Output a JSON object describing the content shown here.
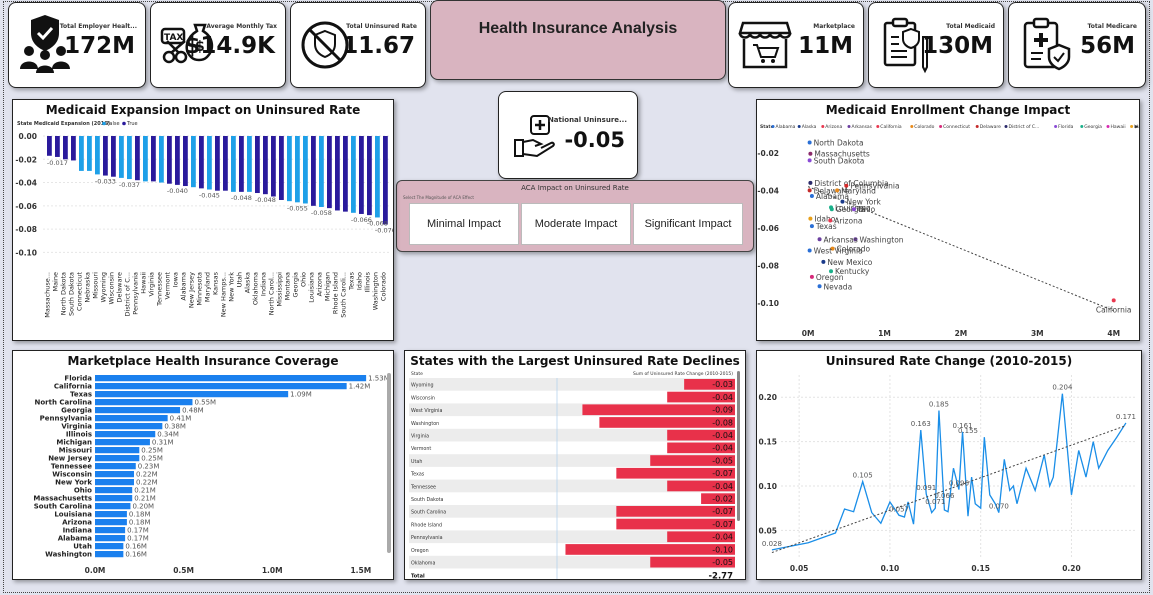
{
  "kpis": {
    "employer": {
      "label": "Total Employer Healt...",
      "value": "172M"
    },
    "tax": {
      "label": "Average Monthly Tax",
      "value": "$14.9K"
    },
    "uninsured": {
      "label": "Total Uninsured Rate",
      "value": "11.67"
    },
    "marketplace": {
      "label": "Marketplace",
      "value": "11M"
    },
    "medicaid": {
      "label": "Total Medicaid",
      "value": "130M"
    },
    "medicare": {
      "label": "Total Medicare",
      "value": "56M"
    }
  },
  "header": {
    "title": "Health Insurance Analysis"
  },
  "national": {
    "label": "National Uninsure...",
    "value": "-0.05"
  },
  "aca_slicer": {
    "title": "ACA Impact on Uninsured Rate",
    "subtitle": "Select The Magnitude of ACA Effect",
    "options": [
      "Minimal Impact",
      "Moderate Impact",
      "Significant Impact"
    ]
  },
  "colors": {
    "false": "#1ea0e8",
    "true": "#2a1a9c",
    "bar": "#1a80ee",
    "decline": "#e8314a",
    "line": "#1a8ee8"
  },
  "chart_data": [
    {
      "id": "medicaid_expansion",
      "type": "bar",
      "title": "Medicaid Expansion Impact on Uninsured Rate",
      "legend_title": "State Medicaid Expansion (2016)",
      "legend": [
        "False",
        "True"
      ],
      "ylim": [
        -0.11,
        0.0
      ],
      "yticks": [
        "0.00",
        "-0.02",
        "-0.04",
        "-0.06",
        "-0.08",
        "-0.10"
      ],
      "categories": [
        "Massachuse...",
        "Maine",
        "North Dakota",
        "South Dakota",
        "Connecticut",
        "Nebraska",
        "Missouri",
        "Wyoming",
        "Wisconsin",
        "Delaware",
        "District of C...",
        "Pennsylvania",
        "Hawaii",
        "Virginia",
        "Tennessee",
        "Vermont",
        "Iowa",
        "Alabama",
        "New Jersey",
        "Minnesota",
        "Maryland",
        "Kansas",
        "New Hamps...",
        "New York",
        "Utah",
        "Alaska",
        "Oklahoma",
        "Indiana",
        "North Carol...",
        "Mississippi",
        "Montana",
        "Georgia",
        "Ohio",
        "Louisiana",
        "Arizona",
        "Michigan",
        "Rhode Island",
        "South Caroli...",
        "Texas",
        "Idaho",
        "Illinois",
        "Washington",
        "Colorado"
      ],
      "values": [
        -0.017,
        -0.018,
        -0.02,
        -0.021,
        -0.03,
        -0.03,
        -0.033,
        -0.034,
        -0.035,
        -0.036,
        -0.037,
        -0.038,
        -0.039,
        -0.039,
        -0.04,
        -0.041,
        -0.042,
        -0.043,
        -0.044,
        -0.045,
        -0.046,
        -0.047,
        -0.047,
        -0.048,
        -0.048,
        -0.048,
        -0.049,
        -0.05,
        -0.052,
        -0.055,
        -0.056,
        -0.057,
        -0.058,
        -0.06,
        -0.061,
        -0.062,
        -0.064,
        -0.065,
        -0.066,
        -0.067,
        -0.068,
        -0.07,
        -0.076
      ],
      "expansion": [
        true,
        true,
        true,
        true,
        false,
        false,
        false,
        true,
        true,
        false,
        false,
        true,
        false,
        true,
        false,
        true,
        true,
        true,
        false,
        true,
        false,
        true,
        true,
        false,
        true,
        false,
        true,
        true,
        true,
        true,
        false,
        false,
        false,
        true,
        false,
        true,
        true,
        true,
        false,
        true,
        true,
        false,
        true
      ],
      "data_labels": [
        {
          "i": 1,
          "text": "-0.017"
        },
        {
          "i": 7,
          "text": "-0.033"
        },
        {
          "i": 10,
          "text": "-0.037"
        },
        {
          "i": 16,
          "text": "-0.040"
        },
        {
          "i": 20,
          "text": "-0.045"
        },
        {
          "i": 24,
          "text": "-0.048"
        },
        {
          "i": 27,
          "text": "-0.048"
        },
        {
          "i": 31,
          "text": "-0.055"
        },
        {
          "i": 34,
          "text": "-0.058"
        },
        {
          "i": 39,
          "text": "-0.066"
        },
        {
          "i": 41,
          "text": "-0.068"
        },
        {
          "i": 42,
          "text": "-0.076"
        }
      ]
    },
    {
      "id": "medicaid_enrollment",
      "type": "scatter",
      "title": "Medicaid Enrollment Change Impact",
      "legend_title": "State",
      "legend": [
        "Alabama",
        "Alaska",
        "Arizona",
        "Arkansas",
        "California",
        "Colorado",
        "Connecticut",
        "Delaware",
        "District of C...",
        "Florida",
        "Georgia",
        "Hawaii",
        "Idaho"
      ],
      "legend_colors": [
        "#2a6fd6",
        "#1a3a8a",
        "#e8384f",
        "#6b3fa0",
        "#e8384f",
        "#e88a1a",
        "#d62a7a",
        "#c42a2a",
        "#2a2a6a",
        "#8a4ad6",
        "#1ab08a",
        "#d62ab0",
        "#e8a01a"
      ],
      "xticks": [
        "0M",
        "1M",
        "2M",
        "3M",
        "4M"
      ],
      "xlim": [
        -0.25,
        4.2
      ],
      "yticks": [
        "-0.02",
        "-0.04",
        "-0.06",
        "-0.08",
        "-0.10"
      ],
      "ylim": [
        -0.11,
        -0.01
      ],
      "points": [
        {
          "label": "North Dakota",
          "x": 0.02,
          "y": -0.0145,
          "c": "#2a6fd6"
        },
        {
          "label": "Massachusetts",
          "x": 0.03,
          "y": -0.0205,
          "c": "#8a2a6a"
        },
        {
          "label": "South Dakota",
          "x": 0.02,
          "y": -0.024,
          "c": "#8a4ad6"
        },
        {
          "label": "District of Columbia",
          "x": 0.03,
          "y": -0.036,
          "c": "#2a2a6a"
        },
        {
          "label": "Pennsylvania",
          "x": 0.5,
          "y": -0.0375,
          "c": "#d62a2a"
        },
        {
          "label": "Delaware",
          "x": 0.02,
          "y": -0.04,
          "c": "#c42a2a"
        },
        {
          "label": "Maryland",
          "x": 0.38,
          "y": -0.04,
          "c": "#e88a1a"
        },
        {
          "label": "Alabama",
          "x": 0.05,
          "y": -0.043,
          "c": "#2a6fd6"
        },
        {
          "label": "New York",
          "x": 0.45,
          "y": -0.046,
          "c": "#1a3a8a"
        },
        {
          "label": "Louisiana",
          "x": 0.3,
          "y": -0.049,
          "c": "#1ab08a"
        },
        {
          "label": "Georgia",
          "x": 0.31,
          "y": -0.05,
          "c": "#1ab08a"
        },
        {
          "label": "Ohio",
          "x": 0.6,
          "y": -0.05,
          "c": "#8a4ad6"
        },
        {
          "label": "Idaho",
          "x": 0.03,
          "y": -0.055,
          "c": "#e8a01a"
        },
        {
          "label": "Arizona",
          "x": 0.29,
          "y": -0.056,
          "c": "#e8384f"
        },
        {
          "label": "Texas",
          "x": 0.05,
          "y": -0.059,
          "c": "#2a6fd6"
        },
        {
          "label": "Washington",
          "x": 0.62,
          "y": -0.066,
          "c": "#6b3fa0"
        },
        {
          "label": "Arkansas",
          "x": 0.15,
          "y": -0.066,
          "c": "#6b3fa0"
        },
        {
          "label": "Colorado",
          "x": 0.32,
          "y": -0.071,
          "c": "#e88a1a"
        },
        {
          "label": "West Virginia",
          "x": 0.02,
          "y": -0.072,
          "c": "#2a6fd6"
        },
        {
          "label": "New Mexico",
          "x": 0.2,
          "y": -0.078,
          "c": "#1a3a8a"
        },
        {
          "label": "Kentucky",
          "x": 0.3,
          "y": -0.083,
          "c": "#1ab08a"
        },
        {
          "label": "Oregon",
          "x": 0.05,
          "y": -0.086,
          "c": "#d62a7a"
        },
        {
          "label": "Nevada",
          "x": 0.15,
          "y": -0.091,
          "c": "#2a6fd6"
        },
        {
          "label": "California",
          "x": 4.0,
          "y": -0.0985,
          "c": "#e8384f"
        }
      ],
      "trend": [
        [
          0.0,
          -0.038
        ],
        [
          4.0,
          -0.104
        ]
      ]
    },
    {
      "id": "marketplace",
      "type": "bar",
      "orientation": "horizontal",
      "title": "Marketplace Health Insurance Coverage",
      "xticks": [
        "0.0M",
        "0.5M",
        "1.0M",
        "1.5M"
      ],
      "xlim": [
        0,
        1.58
      ],
      "categories": [
        "Florida",
        "California",
        "Texas",
        "North Carolina",
        "Georgia",
        "Pennsylvania",
        "Virginia",
        "Illinois",
        "Michigan",
        "Missouri",
        "New Jersey",
        "Tennessee",
        "Wisconsin",
        "New York",
        "Ohio",
        "Massachusetts",
        "South Carolina",
        "Louisiana",
        "Arizona",
        "Indiana",
        "Alabama",
        "Utah",
        "Washington"
      ],
      "values": [
        1.53,
        1.42,
        1.09,
        0.55,
        0.48,
        0.41,
        0.38,
        0.34,
        0.31,
        0.25,
        0.25,
        0.23,
        0.22,
        0.22,
        0.21,
        0.21,
        0.2,
        0.18,
        0.18,
        0.17,
        0.17,
        0.16,
        0.16
      ],
      "value_labels": [
        "1.53M",
        "1.42M",
        "1.09M",
        "0.55M",
        "0.48M",
        "0.41M",
        "0.38M",
        "0.34M",
        "0.31M",
        "0.25M",
        "0.25M",
        "0.23M",
        "0.22M",
        "0.22M",
        "0.21M",
        "0.21M",
        "0.20M",
        "0.18M",
        "0.18M",
        "0.17M",
        "0.17M",
        "0.16M",
        "0.16M"
      ]
    },
    {
      "id": "largest_declines",
      "type": "table",
      "title": "States with the Largest Uninsured Rate Declines",
      "columns": [
        "State",
        "Sum of Uninsured Rate Change (2010-2015)"
      ],
      "rows": [
        {
          "state": "Wyoming",
          "value": -0.03,
          "label": "-0.03"
        },
        {
          "state": "Wisconsin",
          "value": -0.04,
          "label": "-0.04"
        },
        {
          "state": "West Virginia",
          "value": -0.09,
          "label": "-0.09"
        },
        {
          "state": "Washington",
          "value": -0.08,
          "label": "-0.08"
        },
        {
          "state": "Virginia",
          "value": -0.04,
          "label": "-0.04"
        },
        {
          "state": "Vermont",
          "value": -0.04,
          "label": "-0.04"
        },
        {
          "state": "Utah",
          "value": -0.05,
          "label": "-0.05"
        },
        {
          "state": "Texas",
          "value": -0.07,
          "label": "-0.07"
        },
        {
          "state": "Tennessee",
          "value": -0.04,
          "label": "-0.04"
        },
        {
          "state": "South Dakota",
          "value": -0.02,
          "label": "-0.02"
        },
        {
          "state": "South Carolina",
          "value": -0.07,
          "label": "-0.07"
        },
        {
          "state": "Rhode Island",
          "value": -0.07,
          "label": "-0.07"
        },
        {
          "state": "Pennsylvania",
          "value": -0.04,
          "label": "-0.04"
        },
        {
          "state": "Oregon",
          "value": -0.1,
          "label": "-0.10"
        },
        {
          "state": "Oklahoma",
          "value": -0.05,
          "label": "-0.05"
        }
      ],
      "total": {
        "label": "Total",
        "value": "-2.77"
      }
    },
    {
      "id": "uninsured_change",
      "type": "line",
      "title": "Uninsured Rate Change (2010-2015)",
      "xticks": [
        "0.05",
        "0.10",
        "0.15",
        "0.20"
      ],
      "xlim": [
        0.04,
        0.235
      ],
      "yticks": [
        "0.05",
        "0.10",
        "0.15",
        "0.20"
      ],
      "ylim": [
        0.02,
        0.225
      ],
      "x": [
        0.035,
        0.055,
        0.07,
        0.075,
        0.08,
        0.085,
        0.09,
        0.095,
        0.1,
        0.105,
        0.108,
        0.11,
        0.113,
        0.117,
        0.12,
        0.123,
        0.125,
        0.127,
        0.13,
        0.132,
        0.135,
        0.138,
        0.14,
        0.143,
        0.145,
        0.147,
        0.15,
        0.152,
        0.155,
        0.158,
        0.16,
        0.163,
        0.166,
        0.168,
        0.17,
        0.175,
        0.18,
        0.185,
        0.188,
        0.19,
        0.195,
        0.2,
        0.204,
        0.208,
        0.212,
        0.215,
        0.22,
        0.225,
        0.23
      ],
      "y": [
        0.028,
        0.036,
        0.047,
        0.074,
        0.071,
        0.105,
        0.07,
        0.058,
        0.082,
        0.067,
        0.065,
        0.082,
        0.057,
        0.163,
        0.091,
        0.07,
        0.075,
        0.185,
        0.073,
        0.071,
        0.12,
        0.096,
        0.161,
        0.066,
        0.11,
        0.08,
        0.075,
        0.155,
        0.09,
        0.08,
        0.07,
        0.13,
        0.095,
        0.1,
        0.08,
        0.12,
        0.095,
        0.135,
        0.1,
        0.11,
        0.204,
        0.09,
        0.14,
        0.11,
        0.15,
        0.12,
        0.14,
        0.155,
        0.171
      ],
      "point_labels": [
        {
          "x": 0.035,
          "y": 0.028,
          "text": "0.028"
        },
        {
          "x": 0.085,
          "y": 0.105,
          "text": "0.105"
        },
        {
          "x": 0.105,
          "y": 0.067,
          "text": "0.057"
        },
        {
          "x": 0.117,
          "y": 0.163,
          "text": "0.163"
        },
        {
          "x": 0.127,
          "y": 0.185,
          "text": "0.185"
        },
        {
          "x": 0.12,
          "y": 0.091,
          "text": "0.091"
        },
        {
          "x": 0.125,
          "y": 0.075,
          "text": "0.071"
        },
        {
          "x": 0.13,
          "y": 0.082,
          "text": "0.066"
        },
        {
          "x": 0.14,
          "y": 0.161,
          "text": "0.161"
        },
        {
          "x": 0.143,
          "y": 0.155,
          "text": "0.155"
        },
        {
          "x": 0.138,
          "y": 0.096,
          "text": "0.096"
        },
        {
          "x": 0.16,
          "y": 0.07,
          "text": "0.070"
        },
        {
          "x": 0.195,
          "y": 0.204,
          "text": "0.204"
        },
        {
          "x": 0.23,
          "y": 0.171,
          "text": "0.171"
        }
      ],
      "trend": [
        [
          0.035,
          0.025
        ],
        [
          0.23,
          0.168
        ]
      ]
    }
  ]
}
